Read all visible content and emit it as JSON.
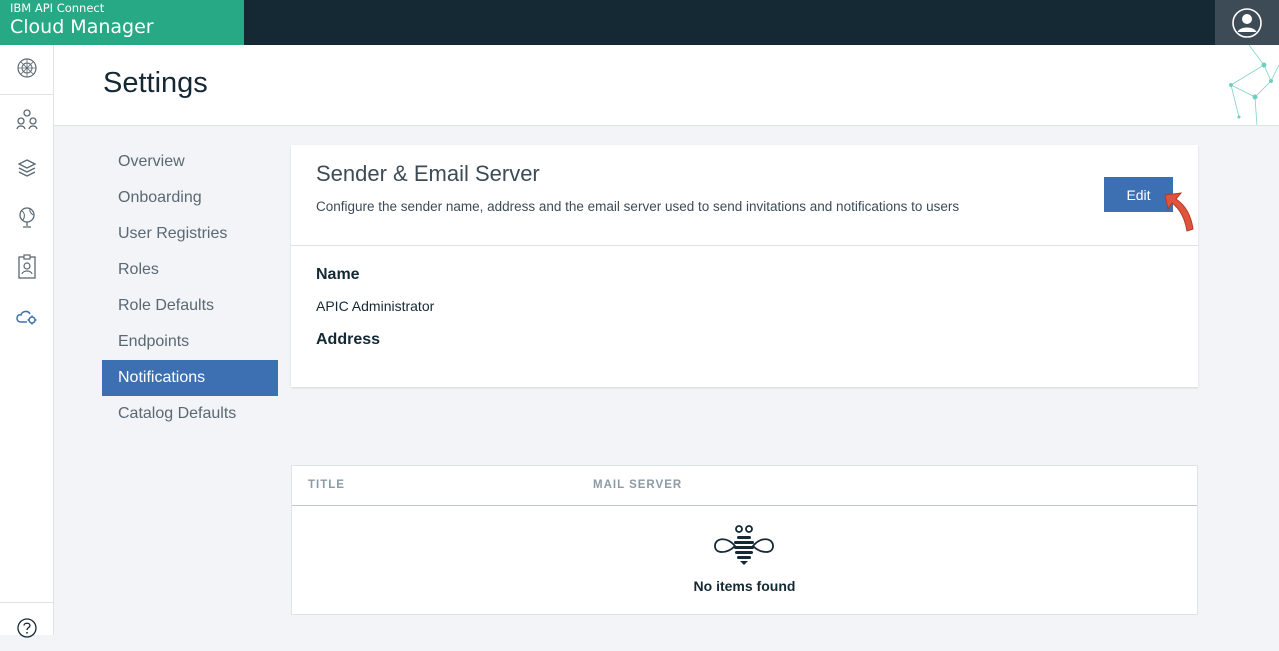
{
  "brand": {
    "product": "IBM API Connect",
    "app": "Cloud Manager"
  },
  "header": {
    "title": "Settings"
  },
  "leftnav": {
    "icons": [
      "home-icon",
      "users-icon",
      "layers-icon",
      "globe-icon",
      "badge-icon",
      "cloud-settings-icon"
    ],
    "help_icon": "help-icon"
  },
  "submenu": {
    "items": [
      {
        "label": "Overview"
      },
      {
        "label": "Onboarding"
      },
      {
        "label": "User Registries"
      },
      {
        "label": "Roles"
      },
      {
        "label": "Role Defaults"
      },
      {
        "label": "Endpoints"
      },
      {
        "label": "Notifications"
      },
      {
        "label": "Catalog Defaults"
      }
    ],
    "active_index": 6
  },
  "card": {
    "title": "Sender & Email Server",
    "description": "Configure the sender name, address and the email server used to send invitations and notifications to users",
    "edit_label": "Edit",
    "name_label": "Name",
    "name_value": "APIC Administrator",
    "address_label": "Address"
  },
  "table": {
    "columns": [
      "TITLE",
      "MAIL SERVER"
    ],
    "empty_text": "No items found"
  },
  "colors": {
    "brand": "#27a985",
    "topbar": "#152935",
    "accent": "#3d70b2",
    "arrow": "#e0533c"
  }
}
